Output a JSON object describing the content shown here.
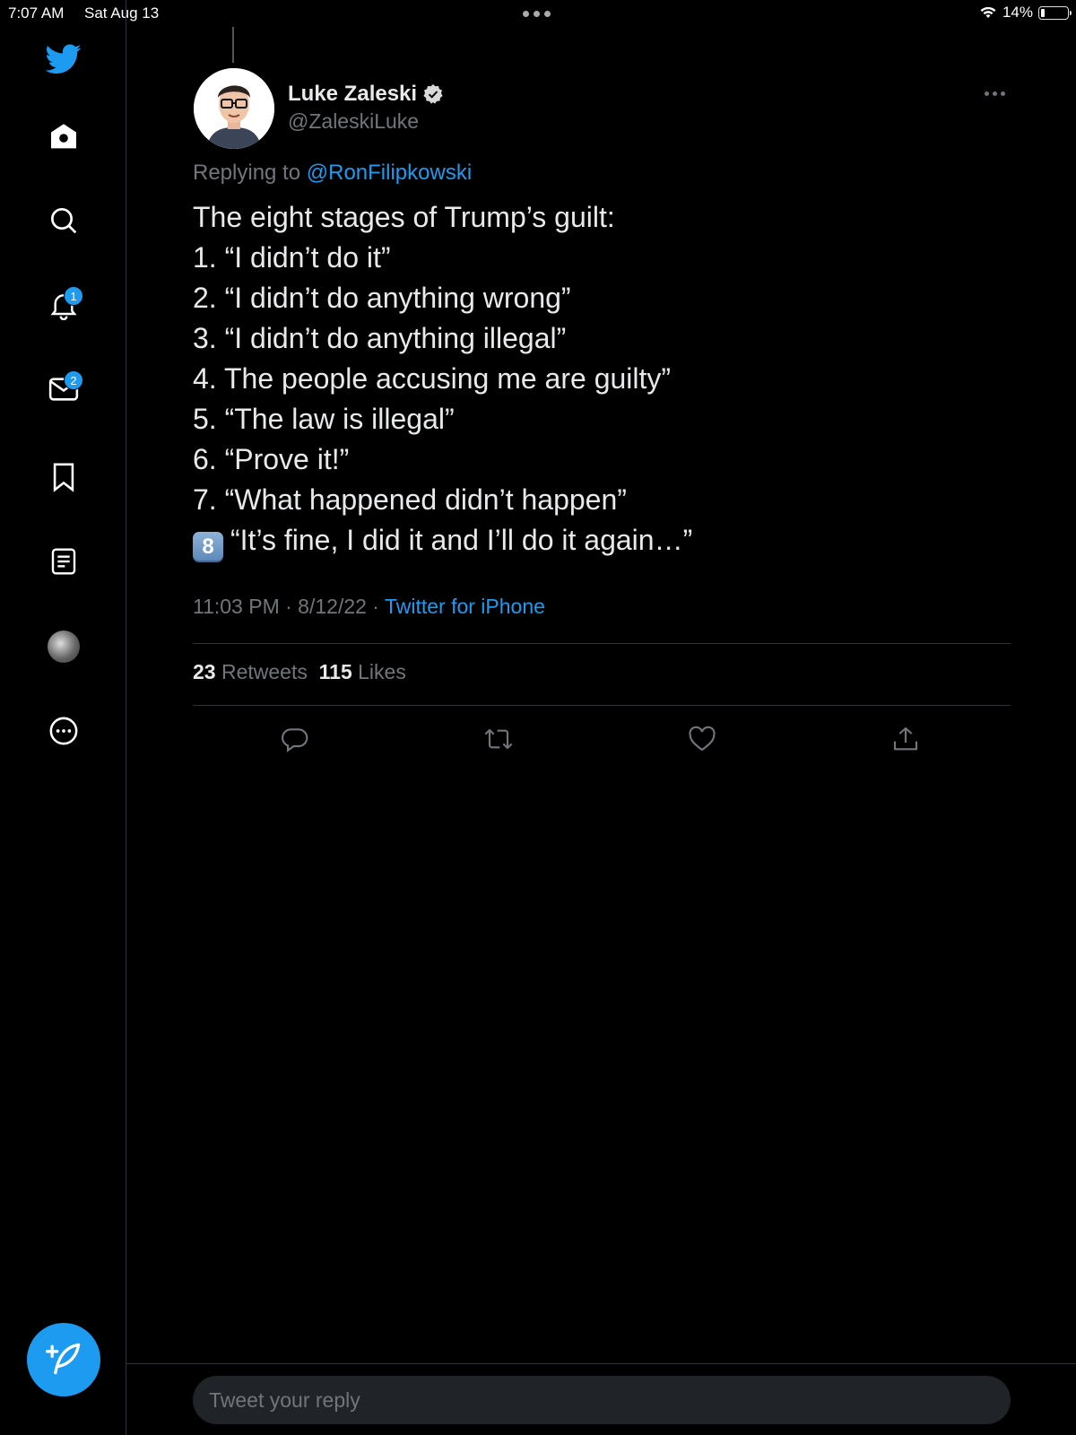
{
  "status_bar": {
    "time": "7:07 AM",
    "date": "Sat Aug 13",
    "battery_percent": "14%",
    "battery_level": 0.14
  },
  "sidebar": {
    "items": [
      {
        "name": "twitter-logo",
        "icon": "bird-icon"
      },
      {
        "name": "home",
        "icon": "home-icon"
      },
      {
        "name": "explore",
        "icon": "search-icon"
      },
      {
        "name": "notifications",
        "icon": "bell-icon",
        "badge": "1"
      },
      {
        "name": "messages",
        "icon": "mail-icon",
        "badge": "2"
      },
      {
        "name": "bookmarks",
        "icon": "bookmark-icon"
      },
      {
        "name": "lists",
        "icon": "list-icon"
      },
      {
        "name": "profile",
        "icon": "avatar"
      },
      {
        "name": "more",
        "icon": "more-circle-icon"
      }
    ],
    "compose_icon": "compose-quill-icon"
  },
  "tweet": {
    "author": {
      "display_name": "Luke Zaleski",
      "handle": "@ZaleskiLuke",
      "verified": true
    },
    "replying_prefix": "Replying to",
    "replying_to": "@RonFilipkowski",
    "lines": [
      "The eight stages of Trump’s guilt:",
      "1. “I didn’t do it”",
      "2. “I didn’t do anything wrong”",
      "3. “I didn’t do anything illegal”",
      "4. The people accusing me are guilty”",
      "5. “The law is illegal”",
      "6. “Prove it!”",
      "7. “What happened didn’t happen”"
    ],
    "last_line_keycap": "8",
    "last_line_text": "“It’s fine, I did it and I’ll do it again…”",
    "timestamp": "11:03 PM · 8/12/22 ·",
    "source": "Twitter for iPhone",
    "retweets_count": "23",
    "retweets_label": "Retweets",
    "likes_count": "115",
    "likes_label": "Likes"
  },
  "reply": {
    "placeholder": "Tweet your reply"
  },
  "colors": {
    "accent": "#1d9bf0",
    "background": "#000000",
    "text": "#e7e9ea",
    "muted": "#71767b",
    "border": "#2f3336"
  }
}
